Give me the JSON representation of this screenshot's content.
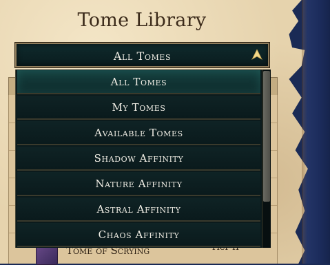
{
  "window": {
    "title": "Tome Library"
  },
  "filter_dropdown": {
    "selected": "All Tomes",
    "arrow_icon": "chevron-up-icon",
    "accent_color": "#f3d98a",
    "options": [
      {
        "label": "All Tomes",
        "selected": true
      },
      {
        "label": "My Tomes",
        "selected": false
      },
      {
        "label": "Available Tomes",
        "selected": false
      },
      {
        "label": "Shadow Affinity",
        "selected": false
      },
      {
        "label": "Nature Affinity",
        "selected": false
      },
      {
        "label": "Astral Affinity",
        "selected": false
      },
      {
        "label": "Chaos Affinity",
        "selected": false
      }
    ]
  },
  "background_list": {
    "visible_item": {
      "name": "Tome of Scrying",
      "extra": "Tier II"
    }
  }
}
